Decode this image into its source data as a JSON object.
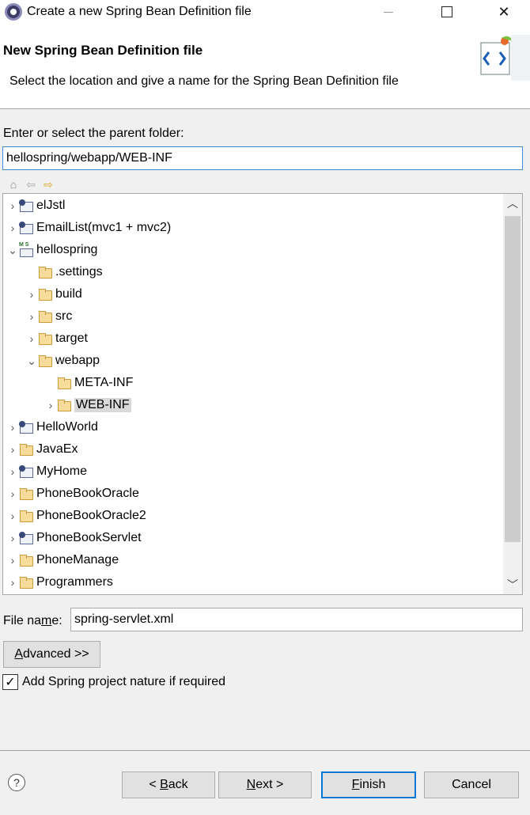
{
  "window": {
    "title": "Create a new Spring Bean Definition file"
  },
  "banner": {
    "title": "New Spring Bean Definition file",
    "description": "Select the location and give a name for the Spring Bean Definition file"
  },
  "parent_folder": {
    "label": "Enter or select the parent folder:",
    "value": "hellospring/webapp/WEB-INF"
  },
  "tree": {
    "items": [
      {
        "label": "elJstl",
        "icon": "project-icon",
        "expand": "collapsed",
        "indent": 0
      },
      {
        "label": "EmailList(mvc1 + mvc2)",
        "icon": "project-icon",
        "expand": "collapsed",
        "indent": 0
      },
      {
        "label": "hellospring",
        "icon": "spring-project-icon",
        "expand": "expanded",
        "indent": 0
      },
      {
        "label": ".settings",
        "icon": "folder-icon",
        "expand": "none",
        "indent": 1
      },
      {
        "label": "build",
        "icon": "folder-icon",
        "expand": "collapsed",
        "indent": 1
      },
      {
        "label": "src",
        "icon": "folder-icon",
        "expand": "collapsed",
        "indent": 1
      },
      {
        "label": "target",
        "icon": "folder-icon",
        "expand": "collapsed",
        "indent": 1
      },
      {
        "label": "webapp",
        "icon": "folder-icon",
        "expand": "expanded",
        "indent": 1
      },
      {
        "label": "META-INF",
        "icon": "folder-icon",
        "expand": "none",
        "indent": 2
      },
      {
        "label": "WEB-INF",
        "icon": "folder-icon",
        "expand": "collapsed",
        "indent": 2,
        "selected": true
      },
      {
        "label": "HelloWorld",
        "icon": "project-icon",
        "expand": "collapsed",
        "indent": 0
      },
      {
        "label": "JavaEx",
        "icon": "folder-project-icon",
        "expand": "collapsed",
        "indent": 0
      },
      {
        "label": "MyHome",
        "icon": "project-icon",
        "expand": "collapsed",
        "indent": 0
      },
      {
        "label": "PhoneBookOracle",
        "icon": "folder-project-icon",
        "expand": "collapsed",
        "indent": 0
      },
      {
        "label": "PhoneBookOracle2",
        "icon": "folder-project-icon",
        "expand": "collapsed",
        "indent": 0
      },
      {
        "label": "PhoneBookServlet",
        "icon": "project-icon",
        "expand": "collapsed",
        "indent": 0
      },
      {
        "label": "PhoneManage",
        "icon": "folder-project-icon",
        "expand": "collapsed",
        "indent": 0
      },
      {
        "label": "Programmers",
        "icon": "folder-project-icon",
        "expand": "collapsed",
        "indent": 0
      }
    ]
  },
  "file_name": {
    "label_pre": "File na",
    "label_mnemonic": "m",
    "label_post": "e:",
    "value": "spring-servlet.xml"
  },
  "advanced_button": {
    "mnemonic": "A",
    "rest": "dvanced >>"
  },
  "spring_nature": {
    "label": "Add Spring project nature if required",
    "checked": true
  },
  "buttons": {
    "back_pre": "< ",
    "back_mnemonic": "B",
    "back_post": "ack",
    "next_mnemonic": "N",
    "next_post": "ext >",
    "finish_mnemonic": "F",
    "finish_post": "inish",
    "cancel": "Cancel"
  },
  "colors": {
    "accent": "#0078d7",
    "selection": "#d9d9d9",
    "folder": "#f7dc9c"
  }
}
